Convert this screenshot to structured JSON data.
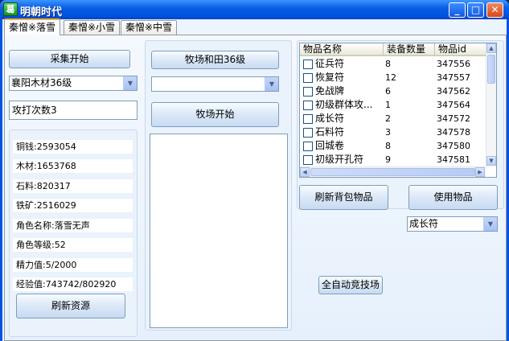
{
  "window": {
    "title": "明朝时代",
    "icon_text": "葛",
    "minimize": "_",
    "maximize": "□",
    "close": "✕"
  },
  "tabs": [
    {
      "label": "秦憎※落雪",
      "active": true
    },
    {
      "label": "秦憎※小雪",
      "active": false
    },
    {
      "label": "秦憎※中雪",
      "active": false
    }
  ],
  "left": {
    "collect_button": "采集开始",
    "location_select": "襄阳木材36级",
    "attack_count": "攻打次数3",
    "stats": [
      "铜钱:2593054",
      "木材:1653768",
      "石料:820317",
      "铁矿:2516029",
      "角色名称:落雪无声",
      "角色等级:52",
      "精力值:5/2000",
      "经验值:743742/802920"
    ],
    "refresh_resources_button": "刷新资源"
  },
  "middle": {
    "field_button": "牧场和田36级",
    "field_select": "",
    "field_start_button": "牧场开始",
    "log_text": ""
  },
  "right": {
    "list_headers": [
      "物品名称",
      "装备数量",
      "物品id"
    ],
    "items": [
      {
        "name": "征兵符",
        "qty": "8",
        "id": "347556"
      },
      {
        "name": "恢复符",
        "qty": "12",
        "id": "347557"
      },
      {
        "name": "免战牌",
        "qty": "6",
        "id": "347562"
      },
      {
        "name": "初级群体攻...",
        "qty": "1",
        "id": "347564"
      },
      {
        "name": "成长符",
        "qty": "2",
        "id": "347572"
      },
      {
        "name": "石料符",
        "qty": "3",
        "id": "347578"
      },
      {
        "name": "回城卷",
        "qty": "8",
        "id": "347580"
      },
      {
        "name": "初级开孔符",
        "qty": "9",
        "id": "347581"
      }
    ],
    "refresh_bag_button": "刷新背包物品",
    "use_item_button": "使用物品",
    "item_select": "成长符",
    "auto_arena_button": "全自动竞技场"
  }
}
